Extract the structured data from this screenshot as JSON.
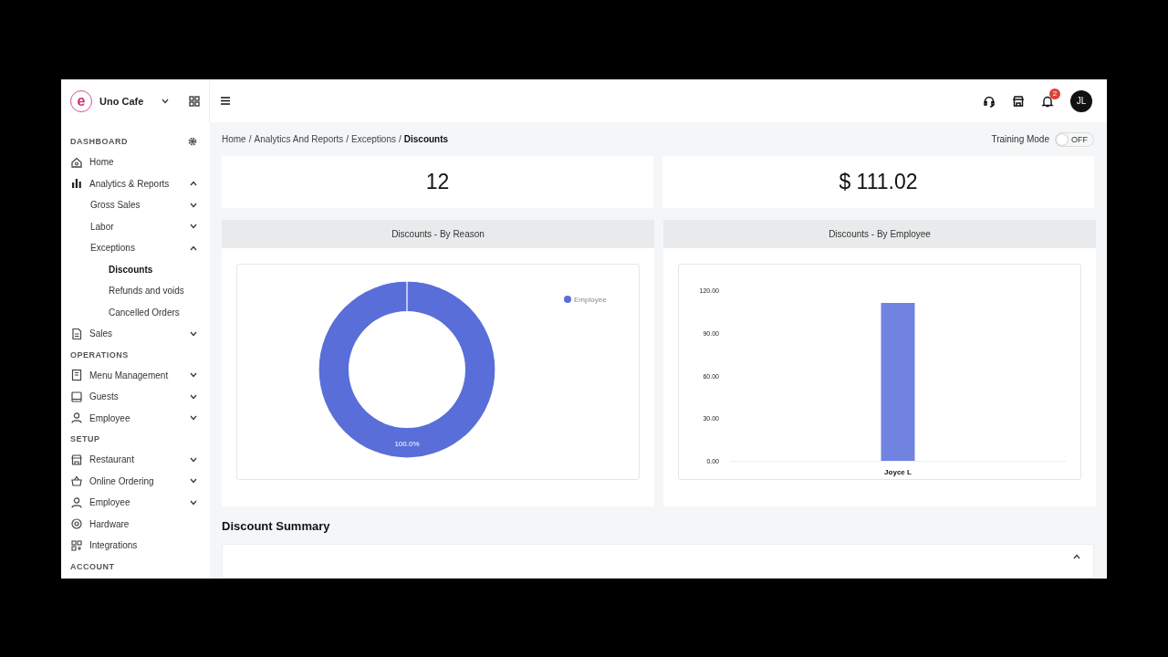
{
  "brand": {
    "name": "Uno Cafe",
    "logo_letter": "e"
  },
  "sidebar": {
    "sections": [
      {
        "title": "DASHBOARD",
        "items": [
          {
            "label": "Home"
          },
          {
            "label": "Analytics & Reports",
            "expanded": true,
            "children": [
              {
                "label": "Gross Sales",
                "expanded": false
              },
              {
                "label": "Labor",
                "expanded": false
              },
              {
                "label": "Exceptions",
                "expanded": true,
                "children": [
                  {
                    "label": "Discounts",
                    "selected": true
                  },
                  {
                    "label": "Refunds and voids",
                    "selected": false
                  },
                  {
                    "label": "Cancelled Orders",
                    "selected": false
                  }
                ]
              }
            ]
          },
          {
            "label": "Sales",
            "expanded": false
          }
        ]
      },
      {
        "title": "OPERATIONS",
        "items": [
          {
            "label": "Menu Management",
            "expanded": false
          },
          {
            "label": "Guests",
            "expanded": false
          },
          {
            "label": "Employee",
            "expanded": false
          }
        ]
      },
      {
        "title": "SETUP",
        "items": [
          {
            "label": "Restaurant",
            "expanded": false
          },
          {
            "label": "Online Ordering",
            "expanded": false
          },
          {
            "label": "Employee",
            "expanded": false
          },
          {
            "label": "Hardware"
          },
          {
            "label": "Integrations"
          }
        ]
      },
      {
        "title": "ACCOUNT"
      }
    ]
  },
  "topbar": {
    "notification_count": "2",
    "avatar_initials": "JL"
  },
  "breadcrumb": {
    "separator": "/",
    "items": [
      "Home",
      "Analytics And Reports",
      "Exceptions",
      "Discounts"
    ]
  },
  "training_mode": {
    "label": "Training Mode",
    "on": false,
    "state_text": "OFF"
  },
  "stats": [
    {
      "value": "12"
    },
    {
      "value": "$ 111.02"
    }
  ],
  "panels": [
    {
      "title": "Discounts - By Reason",
      "chart_data": {
        "type": "donut",
        "categories": [
          "Employee"
        ],
        "values": [
          100
        ],
        "value_labels": [
          "100.0%"
        ]
      }
    },
    {
      "title": "Discounts - By Employee",
      "chart_data": {
        "type": "bar",
        "categories": [
          "Joyce L"
        ],
        "values": [
          111.02
        ],
        "ylim": [
          0,
          120
        ],
        "yticks": [
          {
            "value": 0,
            "label": "0.00"
          },
          {
            "value": 30,
            "label": "30.00"
          },
          {
            "value": 60,
            "label": "60.00"
          },
          {
            "value": 90,
            "label": "90.00"
          },
          {
            "value": 120,
            "label": "120.00"
          }
        ]
      }
    }
  ],
  "summary": {
    "title": "Discount Summary",
    "expanded": true
  }
}
